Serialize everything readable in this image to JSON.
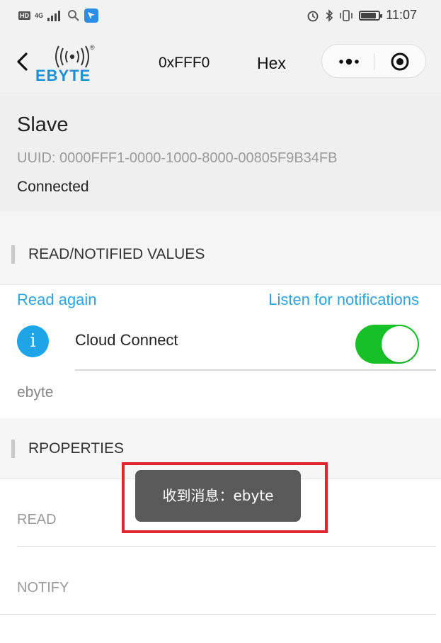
{
  "status_bar": {
    "hd_badge": "HD",
    "network": "4G",
    "time": "11:07",
    "battery_level": 0.85
  },
  "nav": {
    "brand": "EBYTE",
    "brand_mark": "®",
    "title": "0xFFF0",
    "mode": "Hex"
  },
  "device": {
    "name": "Slave",
    "uuid": "UUID: 0000FFF1-0000-1000-8000-00805F9B34FB",
    "status": "Connected"
  },
  "values_section": {
    "title": "READ/NOTIFIED VALUES",
    "read_again": "Read again",
    "listen": "Listen for notifications",
    "cloud_label": "Cloud Connect",
    "cloud_on": true,
    "value": "ebyte"
  },
  "properties_section": {
    "title": "RPOPERTIES",
    "items": [
      "READ",
      "NOTIFY"
    ]
  },
  "toast": {
    "message": "收到消息：ebyte"
  },
  "colors": {
    "accent": "#2ba4dd",
    "toggle_on": "#15c127",
    "highlight": "#e0232f"
  }
}
